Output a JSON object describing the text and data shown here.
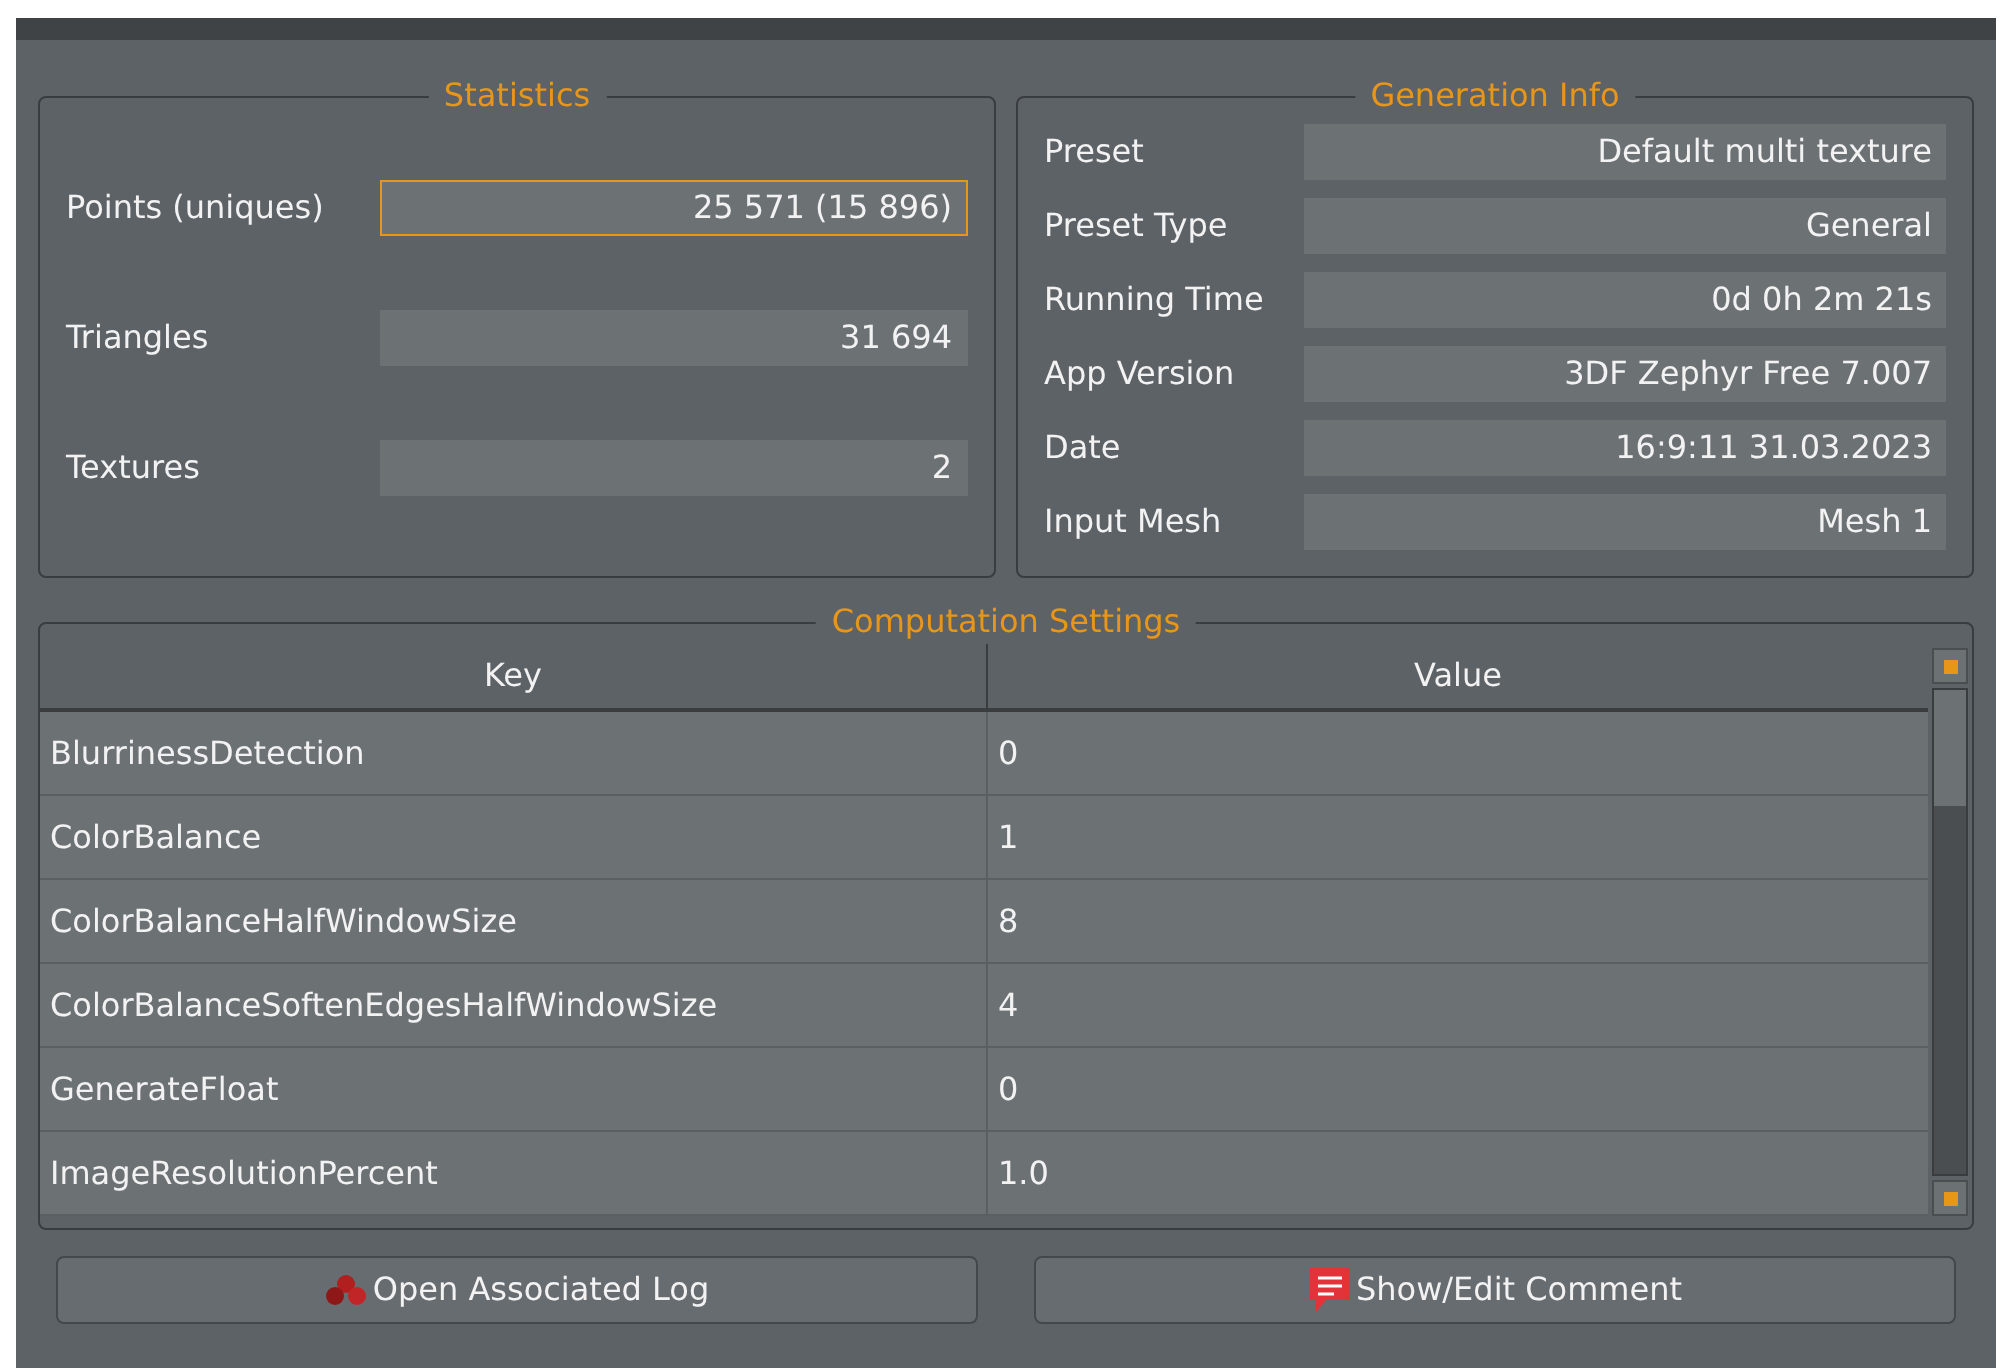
{
  "statistics": {
    "title": "Statistics",
    "fields": [
      {
        "label": "Points (uniques)",
        "value": "25 571 (15 896)",
        "focused": true
      },
      {
        "label": "Triangles",
        "value": "31 694",
        "focused": false
      },
      {
        "label": "Textures",
        "value": "2",
        "focused": false
      }
    ]
  },
  "generation_info": {
    "title": "Generation Info",
    "fields": [
      {
        "label": "Preset",
        "value": "Default multi texture"
      },
      {
        "label": "Preset Type",
        "value": "General"
      },
      {
        "label": "Running Time",
        "value": "0d 0h 2m 21s"
      },
      {
        "label": "App Version",
        "value": "3DF Zephyr Free 7.007"
      },
      {
        "label": "Date",
        "value": "16:9:11 31.03.2023"
      },
      {
        "label": "Input Mesh",
        "value": "Mesh 1"
      }
    ]
  },
  "computation_settings": {
    "title": "Computation Settings",
    "columns": [
      "Key",
      "Value"
    ],
    "rows": [
      [
        "BlurrinessDetection",
        "0"
      ],
      [
        "ColorBalance",
        "1"
      ],
      [
        "ColorBalanceHalfWindowSize",
        "8"
      ],
      [
        "ColorBalanceSoftenEdgesHalfWindowSize",
        "4"
      ],
      [
        "GenerateFloat",
        "0"
      ],
      [
        "ImageResolutionPercent",
        "1.0"
      ]
    ]
  },
  "buttons": [
    {
      "label": "Open Associated Log"
    },
    {
      "label": "Show/Edit Comment"
    }
  ]
}
